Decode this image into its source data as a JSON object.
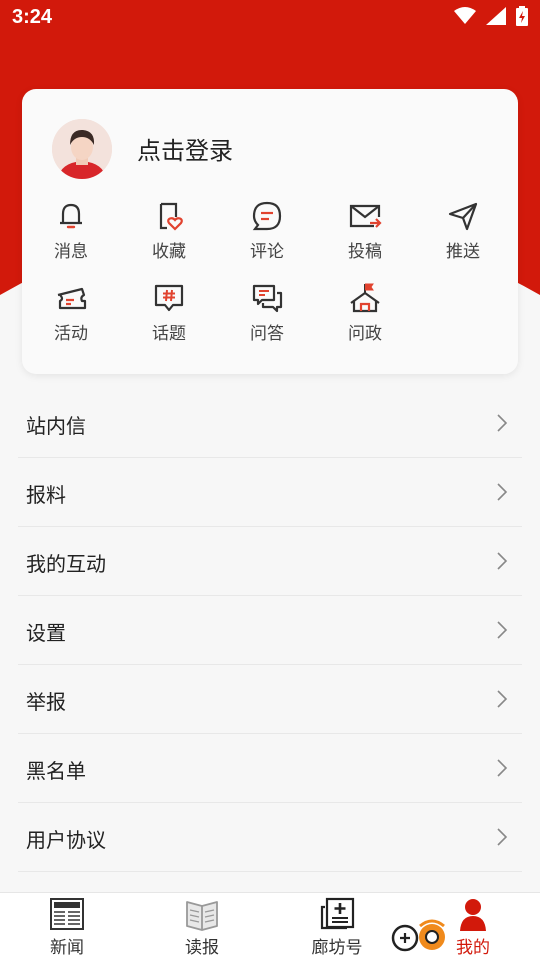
{
  "status": {
    "time": "3:24"
  },
  "profile": {
    "login_label": "点击登录"
  },
  "quick_icons": [
    {
      "label": "消息",
      "icon": "bell-icon"
    },
    {
      "label": "收藏",
      "icon": "favorite-icon"
    },
    {
      "label": "评论",
      "icon": "comment-icon"
    },
    {
      "label": "投稿",
      "icon": "submit-mail-icon"
    },
    {
      "label": "推送",
      "icon": "send-icon"
    },
    {
      "label": "活动",
      "icon": "ticket-icon"
    },
    {
      "label": "话题",
      "icon": "topic-hash-icon"
    },
    {
      "label": "问答",
      "icon": "qa-icon"
    },
    {
      "label": "问政",
      "icon": "government-icon"
    }
  ],
  "menu": [
    {
      "label": "站内信"
    },
    {
      "label": "报料"
    },
    {
      "label": "我的互动"
    },
    {
      "label": "设置"
    },
    {
      "label": "举报"
    },
    {
      "label": "黑名单"
    },
    {
      "label": "用户协议"
    }
  ],
  "tabs": [
    {
      "label": "新闻",
      "icon": "newspaper-icon"
    },
    {
      "label": "读报",
      "icon": "open-book-icon"
    },
    {
      "label": "廊坊号",
      "icon": "plus-document-icon"
    },
    {
      "label": "我的",
      "icon": "user-icon"
    }
  ],
  "colors": {
    "brand_red": "#d2190b",
    "icon_dark": "#333333",
    "accent_red": "#e1432f"
  }
}
